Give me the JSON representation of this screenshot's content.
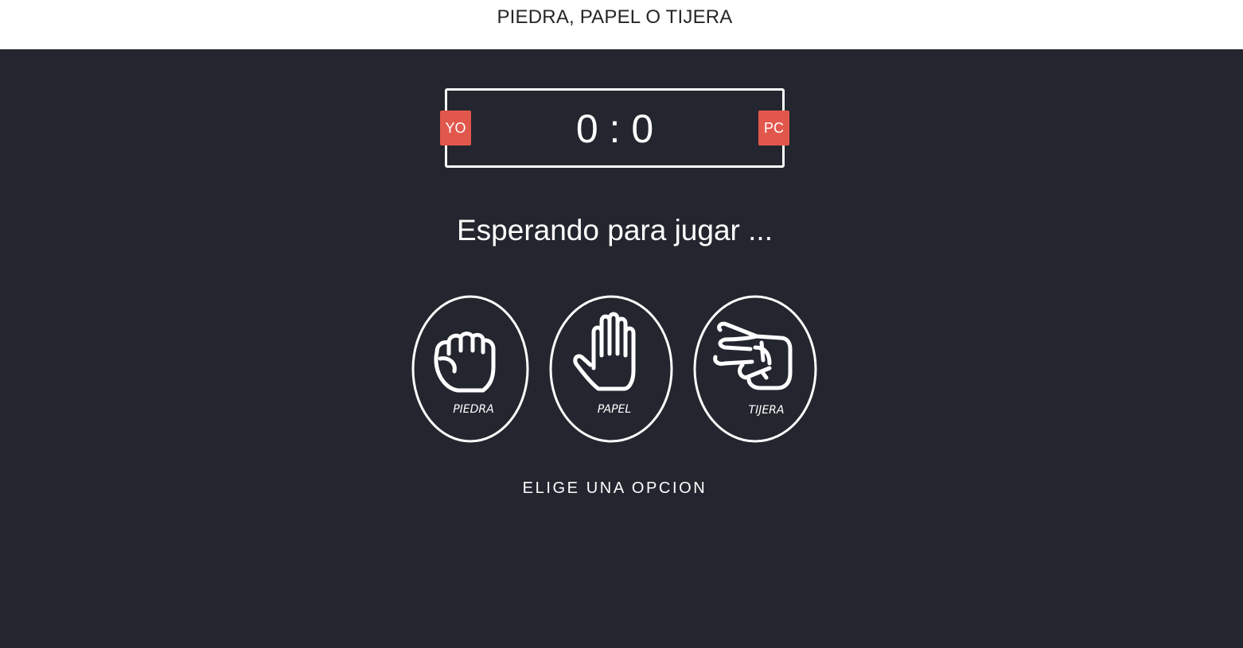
{
  "app": {
    "title": "PIEDRA, PAPEL O TIJERA"
  },
  "scoreboard": {
    "user_label": "YO",
    "computer_label": "PC",
    "user_score": "0",
    "separator": ":",
    "computer_score": "0"
  },
  "status": {
    "message": "Esperando para jugar ..."
  },
  "choices": [
    {
      "label": "PIEDRA",
      "icon": "rock-hand-icon"
    },
    {
      "label": "PAPEL",
      "icon": "paper-hand-icon"
    },
    {
      "label": "TIJERA",
      "icon": "scissors-hand-icon"
    }
  ],
  "prompt": {
    "text": "ELIGE UNA OPCION"
  },
  "colors": {
    "background": "#23262e",
    "header": "#ffffff",
    "badge": "#e2574c"
  }
}
